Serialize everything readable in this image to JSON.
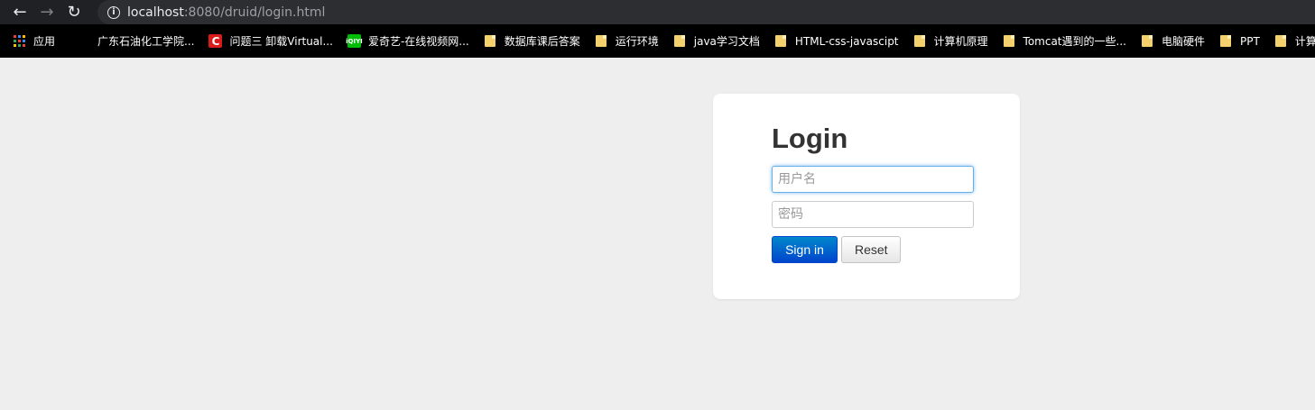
{
  "browser": {
    "url_host": "localhost",
    "url_rest": ":8080/druid/login.html",
    "bookmarks": [
      {
        "label": "应用",
        "icon": "apps-grid-icon"
      },
      {
        "label": "广东石油化工学院...",
        "icon": "blank-favicon"
      },
      {
        "label": "问题三 卸载Virtual...",
        "icon": "csdn-c-icon"
      },
      {
        "label": "爱奇艺-在线视频网...",
        "icon": "iqiyi-icon"
      },
      {
        "label": "数据库课后答案",
        "icon": "folder-icon"
      },
      {
        "label": "运行环境",
        "icon": "folder-icon"
      },
      {
        "label": "java学习文档",
        "icon": "folder-icon"
      },
      {
        "label": "HTML-css-javascipt",
        "icon": "folder-icon"
      },
      {
        "label": "计算机原理",
        "icon": "folder-icon"
      },
      {
        "label": "Tomcat遇到的一些...",
        "icon": "folder-icon"
      },
      {
        "label": "电脑硬件",
        "icon": "folder-icon"
      },
      {
        "label": "PPT",
        "icon": "folder-icon"
      },
      {
        "label": "计算",
        "icon": "folder-icon"
      }
    ]
  },
  "login": {
    "title": "Login",
    "username_placeholder": "用户名",
    "password_placeholder": "密码",
    "signin_label": "Sign in",
    "reset_label": "Reset"
  },
  "colors": {
    "page_bg": "#eeeeee",
    "signin_top": "#0088cc",
    "signin_bottom": "#0044cc",
    "focus_border": "#66afe9"
  }
}
